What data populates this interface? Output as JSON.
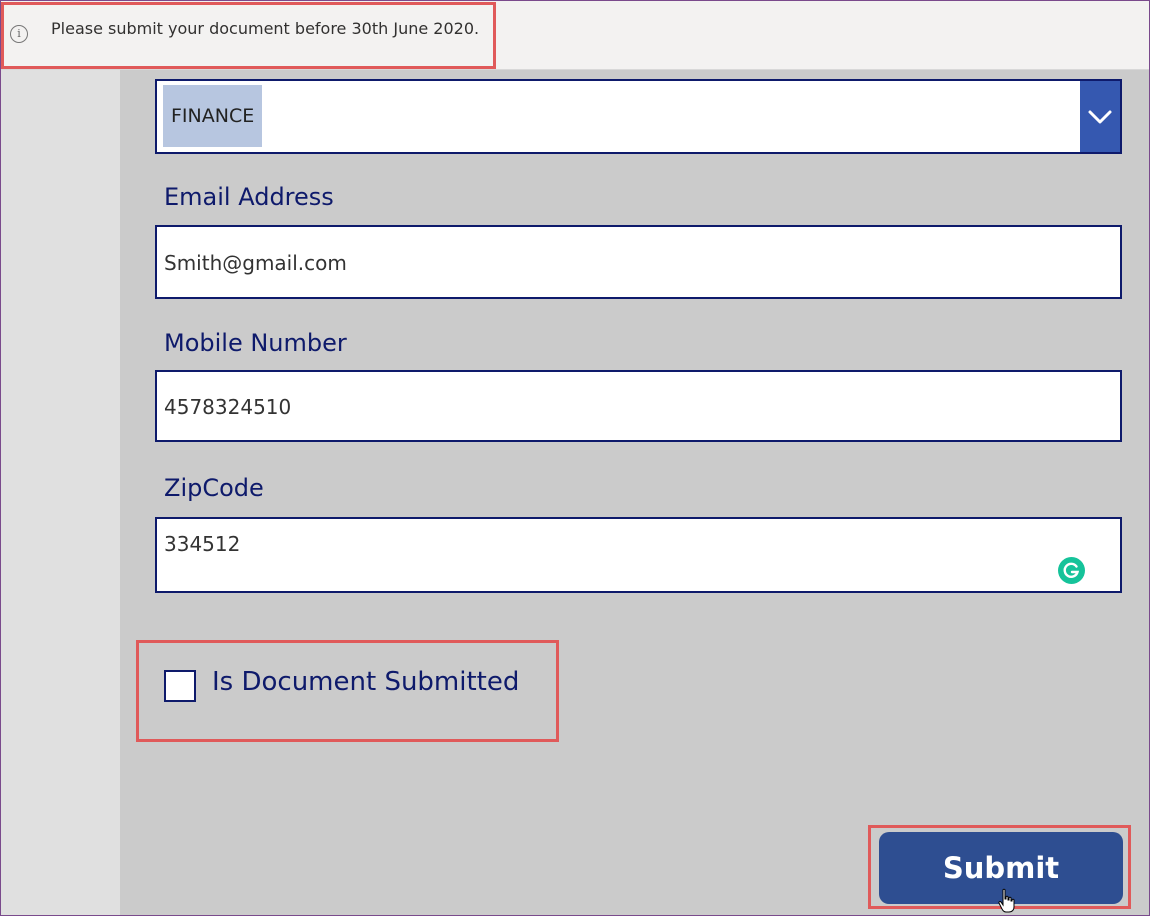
{
  "notification": {
    "text": "Please submit your document before 30th June 2020.",
    "icon": "info-icon"
  },
  "department": {
    "selected": "FINANCE",
    "icon": "chevron-down-icon"
  },
  "email": {
    "label": "Email Address",
    "value": "Smith@gmail.com"
  },
  "mobile": {
    "label": "Mobile Number",
    "value": "4578324510"
  },
  "zipcode": {
    "label": "ZipCode",
    "value": "334512",
    "extension_icon": "grammarly-icon"
  },
  "document_submitted": {
    "label": "Is Document Submitted",
    "checked": false
  },
  "submit": {
    "label": "Submit"
  },
  "colors": {
    "accent": "#2e4e91",
    "label": "#0e1a6b",
    "highlight": "#e05a5a",
    "notification_bg": "#f3f2f1",
    "form_bg": "#cbcbcb"
  }
}
